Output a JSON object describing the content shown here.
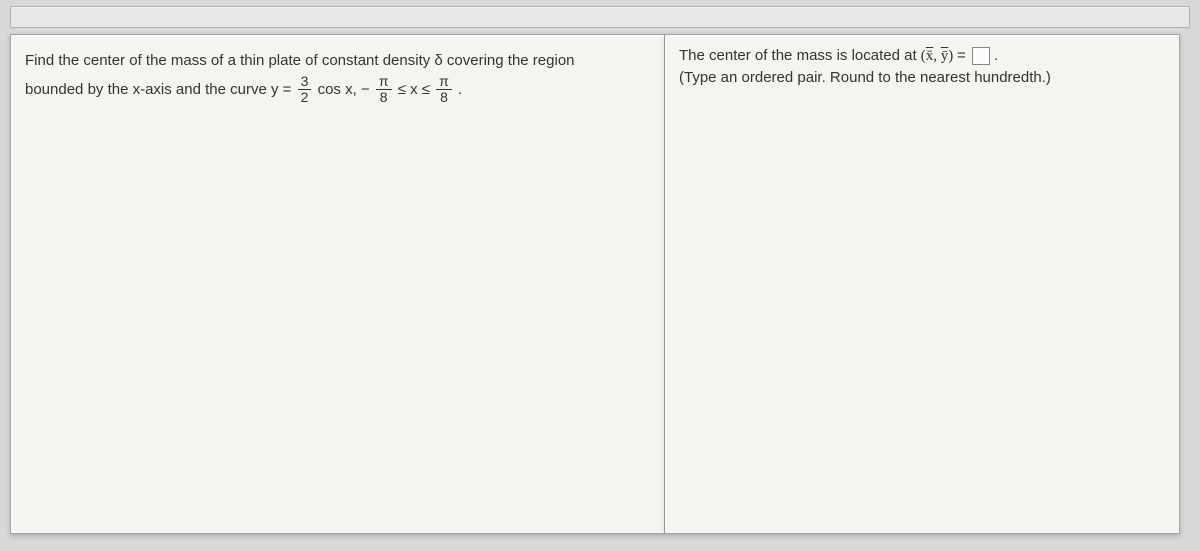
{
  "problem": {
    "line1_a": "Find the center of the mass of a thin plate of constant density δ covering the region",
    "line2_a": "bounded by the x-axis and the curve y =",
    "frac1_num": "3",
    "frac1_den": "2",
    "line2_b": " cos x,  −",
    "frac2_num": "π",
    "frac2_den": "8",
    "line2_c": " ≤ x ≤ ",
    "frac3_num": "π",
    "frac3_den": "8",
    "line2_d": "."
  },
  "answer": {
    "prefix": "The center of the mass is located at ",
    "tuple_open": "(",
    "x_sym": "x̄",
    "comma": ", ",
    "y_sym": "ȳ",
    "tuple_close": ")",
    "equals": " = ",
    "period": ".",
    "hint": "(Type an ordered pair. Round to the nearest hundredth.)"
  }
}
